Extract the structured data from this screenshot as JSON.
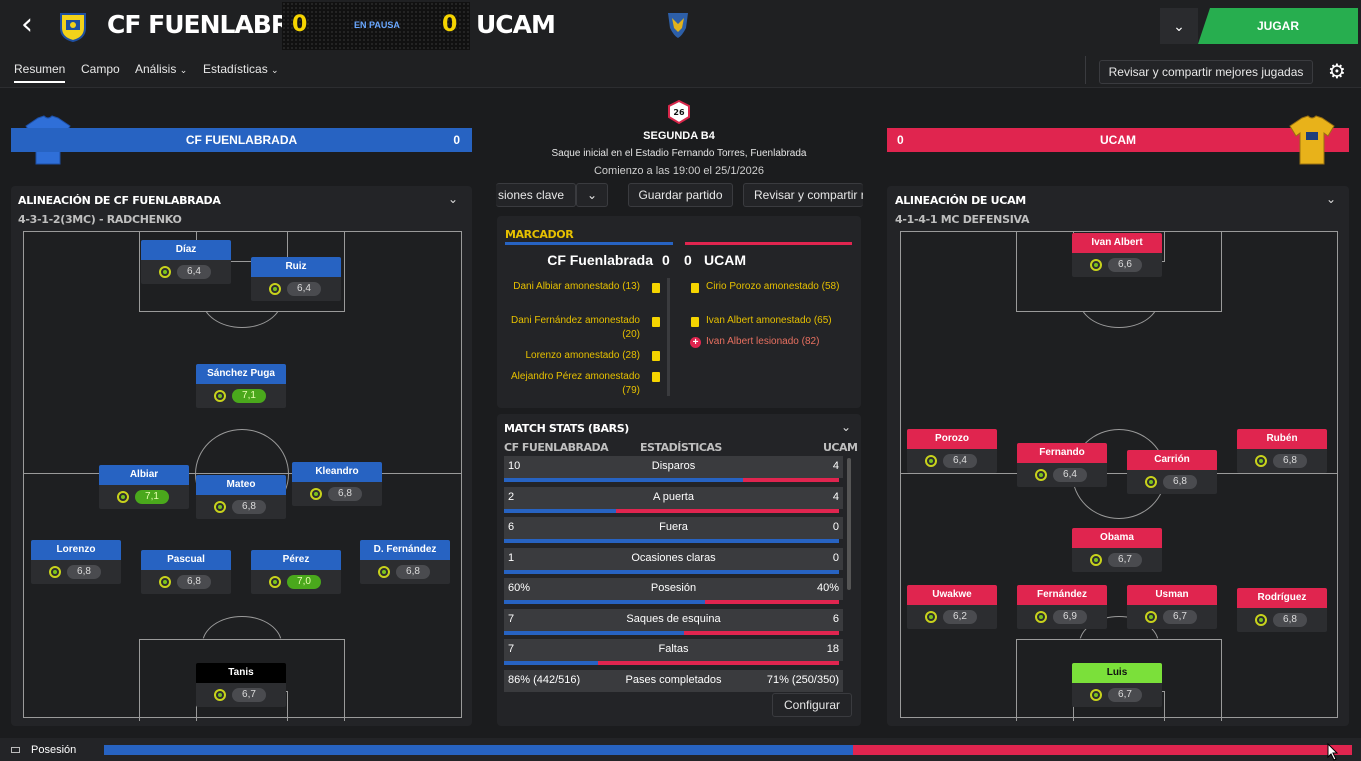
{
  "header": {
    "back_icon": "back-arrow-icon",
    "home_team": "CF FUENLABRADA",
    "away_team": "UCAM",
    "home_score": "0",
    "away_score": "0",
    "status": "EN PAUSA",
    "continue_label": "JUGAR"
  },
  "nav": {
    "tabs": [
      "Resumen",
      "Campo",
      "Análisis",
      "Estadísticas"
    ],
    "share_label": "Revisar y compartir mejores jugadas"
  },
  "home_banner": {
    "name": "CF FUENLABRADA",
    "score": "0"
  },
  "away_banner": {
    "name": "UCAM",
    "score": "0"
  },
  "match_info": {
    "badge": "26",
    "competition": "SEGUNDA B4",
    "venue": "Saque inicial en el Estadio Fernando Torres, Fuenlabrada",
    "start": "Comienzo a las 19:00 el 25/1/2026"
  },
  "center_buttons": {
    "key_chances": "siones clave",
    "save_match": "Guardar partido",
    "share": "Revisar y compartir r"
  },
  "home_lineup": {
    "title": "ALINEACIÓN DE CF FUENLABRADA",
    "formation": "4-3-1-2(3MC) - RADCHENKO",
    "players": [
      {
        "name": "Díaz",
        "rating": "6,4"
      },
      {
        "name": "Ruiz",
        "rating": "6,4"
      },
      {
        "name": "Sánchez Puga",
        "rating": "7,1"
      },
      {
        "name": "Albiar",
        "rating": "7,1"
      },
      {
        "name": "Mateo",
        "rating": "6,8"
      },
      {
        "name": "Kleandro",
        "rating": "6,8"
      },
      {
        "name": "Lorenzo",
        "rating": "6,8"
      },
      {
        "name": "Pascual",
        "rating": "6,8"
      },
      {
        "name": "Pérez",
        "rating": "7,0"
      },
      {
        "name": "D. Fernández",
        "rating": "6,8"
      },
      {
        "name": "Tanis",
        "rating": "6,7"
      }
    ]
  },
  "away_lineup": {
    "title": "ALINEACIÓN DE UCAM",
    "formation": "4-1-4-1 MC DEFENSIVA",
    "players": [
      {
        "name": "Ivan Albert",
        "rating": "6,6"
      },
      {
        "name": "Porozo",
        "rating": "6,4"
      },
      {
        "name": "Fernando",
        "rating": "6,4"
      },
      {
        "name": "Carrión",
        "rating": "6,8"
      },
      {
        "name": "Rubén",
        "rating": "6,8"
      },
      {
        "name": "Obama",
        "rating": "6,7"
      },
      {
        "name": "Uwakwe",
        "rating": "6,2"
      },
      {
        "name": "Fernández",
        "rating": "6,9"
      },
      {
        "name": "Usman",
        "rating": "6,7"
      },
      {
        "name": "Rodríguez",
        "rating": "6,8"
      },
      {
        "name": "Luis",
        "rating": "6,7"
      }
    ]
  },
  "scoreboard": {
    "title": "MARCADOR",
    "home": "CF Fuenlabrada",
    "home_score": "0",
    "away_score": "0",
    "away": "UCAM",
    "home_events": [
      "Dani Albiar amonestado (13)",
      "Dani Fernández amonestado (20)",
      "Lorenzo amonestado (28)",
      "Alejandro Pérez amonestado (79)"
    ],
    "away_events": [
      "Cirio Porozo amonestado (58)",
      "Ivan Albert amonestado (65)",
      "Ivan Albert lesionado (82)"
    ]
  },
  "match_stats": {
    "title": "MATCH STATS (BARS)",
    "home_label": "CF FUENLABRADA",
    "center_label": "ESTADÍSTICAS",
    "away_label": "UCAM",
    "rows": [
      {
        "label": "Disparos",
        "home": "10",
        "away": "4",
        "home_share": 0.714
      },
      {
        "label": "A puerta",
        "home": "2",
        "away": "4",
        "home_share": 0.333
      },
      {
        "label": "Fuera",
        "home": "6",
        "away": "0",
        "home_share": 1.0
      },
      {
        "label": "Ocasiones claras",
        "home": "1",
        "away": "0",
        "home_share": 1.0
      },
      {
        "label": "Posesión",
        "home": "60%",
        "away": "40%",
        "home_share": 0.6
      },
      {
        "label": "Saques de esquina",
        "home": "7",
        "away": "6",
        "home_share": 0.538
      },
      {
        "label": "Faltas",
        "home": "7",
        "away": "18",
        "home_share": 0.28
      },
      {
        "label": "Pases completados",
        "home": "86% (442/516)",
        "away": "71% (250/350)",
        "home_share": null
      }
    ],
    "configure": "Configurar"
  },
  "footer": {
    "label": "Posesión",
    "home_share": 0.6
  },
  "colors": {
    "home": "#2763c2",
    "away": "#e0254f",
    "play": "#27ae4f",
    "accent": "#f5d400"
  }
}
